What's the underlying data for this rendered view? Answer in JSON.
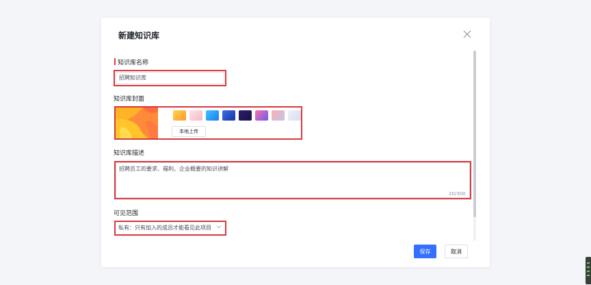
{
  "dialog": {
    "title": "新建知识库",
    "close_icon": "close-icon",
    "fields": {
      "name_label": "知识库名称",
      "name_value": "招聘知识库",
      "cover_label": "知识库封面",
      "upload_label": "本地上传",
      "description_label": "知识库描述",
      "description_value": "招聘员工的要求、福利、企业概要的知识讲解",
      "description_counter": "20/300",
      "visibility_label": "可见范围",
      "visibility_value": "私有：只有加入的成员才能看见此项目",
      "visibility_icon": "chevron-down-icon"
    },
    "buttons": {
      "save": "保存",
      "cancel": "取消"
    }
  },
  "colors": {
    "primary": "#3370ff",
    "highlight": "#d9363e",
    "required_mark": "#e03a3a"
  }
}
